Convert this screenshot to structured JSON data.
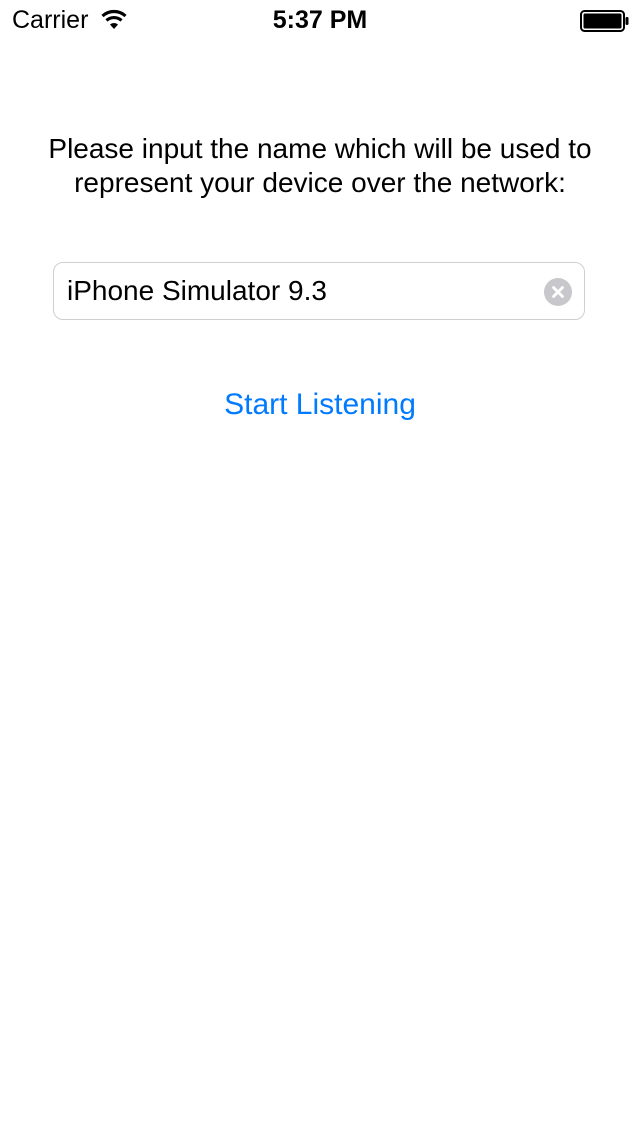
{
  "status_bar": {
    "carrier": "Carrier",
    "time": "5:37 PM",
    "wifi_icon": "wifi-icon",
    "battery_icon": "battery-full-icon"
  },
  "prompt": {
    "text": "Please input the name which will be used to represent your device over the network:"
  },
  "device_name_field": {
    "value": "iPhone Simulator 9.3",
    "clear_icon": "clear-circle-x-icon"
  },
  "start_button": {
    "label": "Start Listening"
  },
  "colors": {
    "accent": "#007aff",
    "background": "#ffffff",
    "text": "#000000",
    "field_border": "#cfcfcf",
    "clear_icon": "#c7c7cc"
  }
}
